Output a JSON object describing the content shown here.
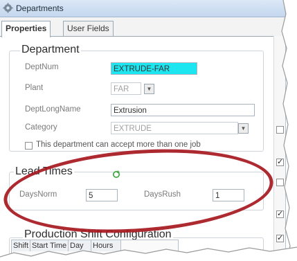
{
  "window": {
    "title": "Departments",
    "accent": "#c4d7ee"
  },
  "tabs": [
    {
      "label": "Properties",
      "active": true
    },
    {
      "label": "User Fields",
      "active": false
    }
  ],
  "department": {
    "group_title": "Department",
    "deptnum_label": "DeptNum",
    "deptnum_value": "EXTRUDE-FAR",
    "plant_label": "Plant",
    "plant_value": "FAR",
    "longname_label": "DeptLongName",
    "longname_value": "Extrusion",
    "category_label": "Category",
    "category_value": "EXTRUDE",
    "checkbox_label": "This department can accept more than one job"
  },
  "lead_times": {
    "group_title": "Lead Times",
    "days_norm_label": "DaysNorm",
    "days_norm_value": "5",
    "days_rush_label": "DaysRush",
    "days_rush_value": "1"
  },
  "shift_config": {
    "group_title": "Production Shift Configuration",
    "columns": [
      "Shift",
      "Start Time",
      "Day",
      "Hours"
    ]
  },
  "right_checkboxes": [
    true,
    true,
    false,
    false,
    true
  ],
  "annotation_color": "#a6181f"
}
